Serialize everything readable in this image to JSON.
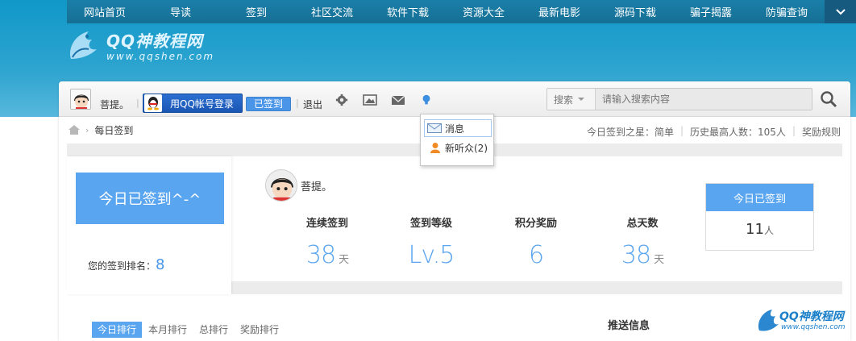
{
  "nav": {
    "items": [
      "网站首页",
      "导读",
      "签到",
      "社区交流",
      "软件下载",
      "资源大全",
      "最新电影",
      "源码下载",
      "骗子揭露",
      "防骗查询"
    ],
    "toggle_icon": "chevron-down-icon"
  },
  "logo": {
    "title": "QQ神教程网",
    "url": "www.qqshen.com"
  },
  "toolbar": {
    "username": "菩提。",
    "sep": "|",
    "qq_login": "用QQ帐号登录",
    "signed_label": "已签到",
    "logout": "退出",
    "icons": [
      "gear-icon",
      "image-icon",
      "mail-icon",
      "bulb-icon"
    ]
  },
  "search": {
    "type_label": "搜索",
    "placeholder": "请输入搜索内容"
  },
  "popover": {
    "messages": "消息",
    "followers": "新听众(2)",
    "close": "×"
  },
  "breadcrumb": {
    "current": "每日签到"
  },
  "header_stats": {
    "star": "今日签到之星：简单",
    "record": "历史最高人数：105人",
    "rules": "奖励规则",
    "sep": "|"
  },
  "signin": {
    "big_button": "今日已签到^-^",
    "rank_label": "您的签到排名：",
    "rank_value": "8",
    "name": "菩提。",
    "metrics": [
      {
        "label": "连续签到",
        "value": "38",
        "unit": "天"
      },
      {
        "label": "签到等级",
        "value": "Lv.5",
        "unit": ""
      },
      {
        "label": "积分奖励",
        "value": "6",
        "unit": ""
      },
      {
        "label": "总天数",
        "value": "38",
        "unit": "天"
      }
    ],
    "today_head": "今日已签到",
    "today_count": "11",
    "today_unit": "人"
  },
  "tabs": [
    "今日排行",
    "本月排行",
    "总排行",
    "奖励排行"
  ],
  "push_title": "推送信息",
  "watermark": {
    "title": "QQ神教程网",
    "url": "www.qqshen.com"
  }
}
